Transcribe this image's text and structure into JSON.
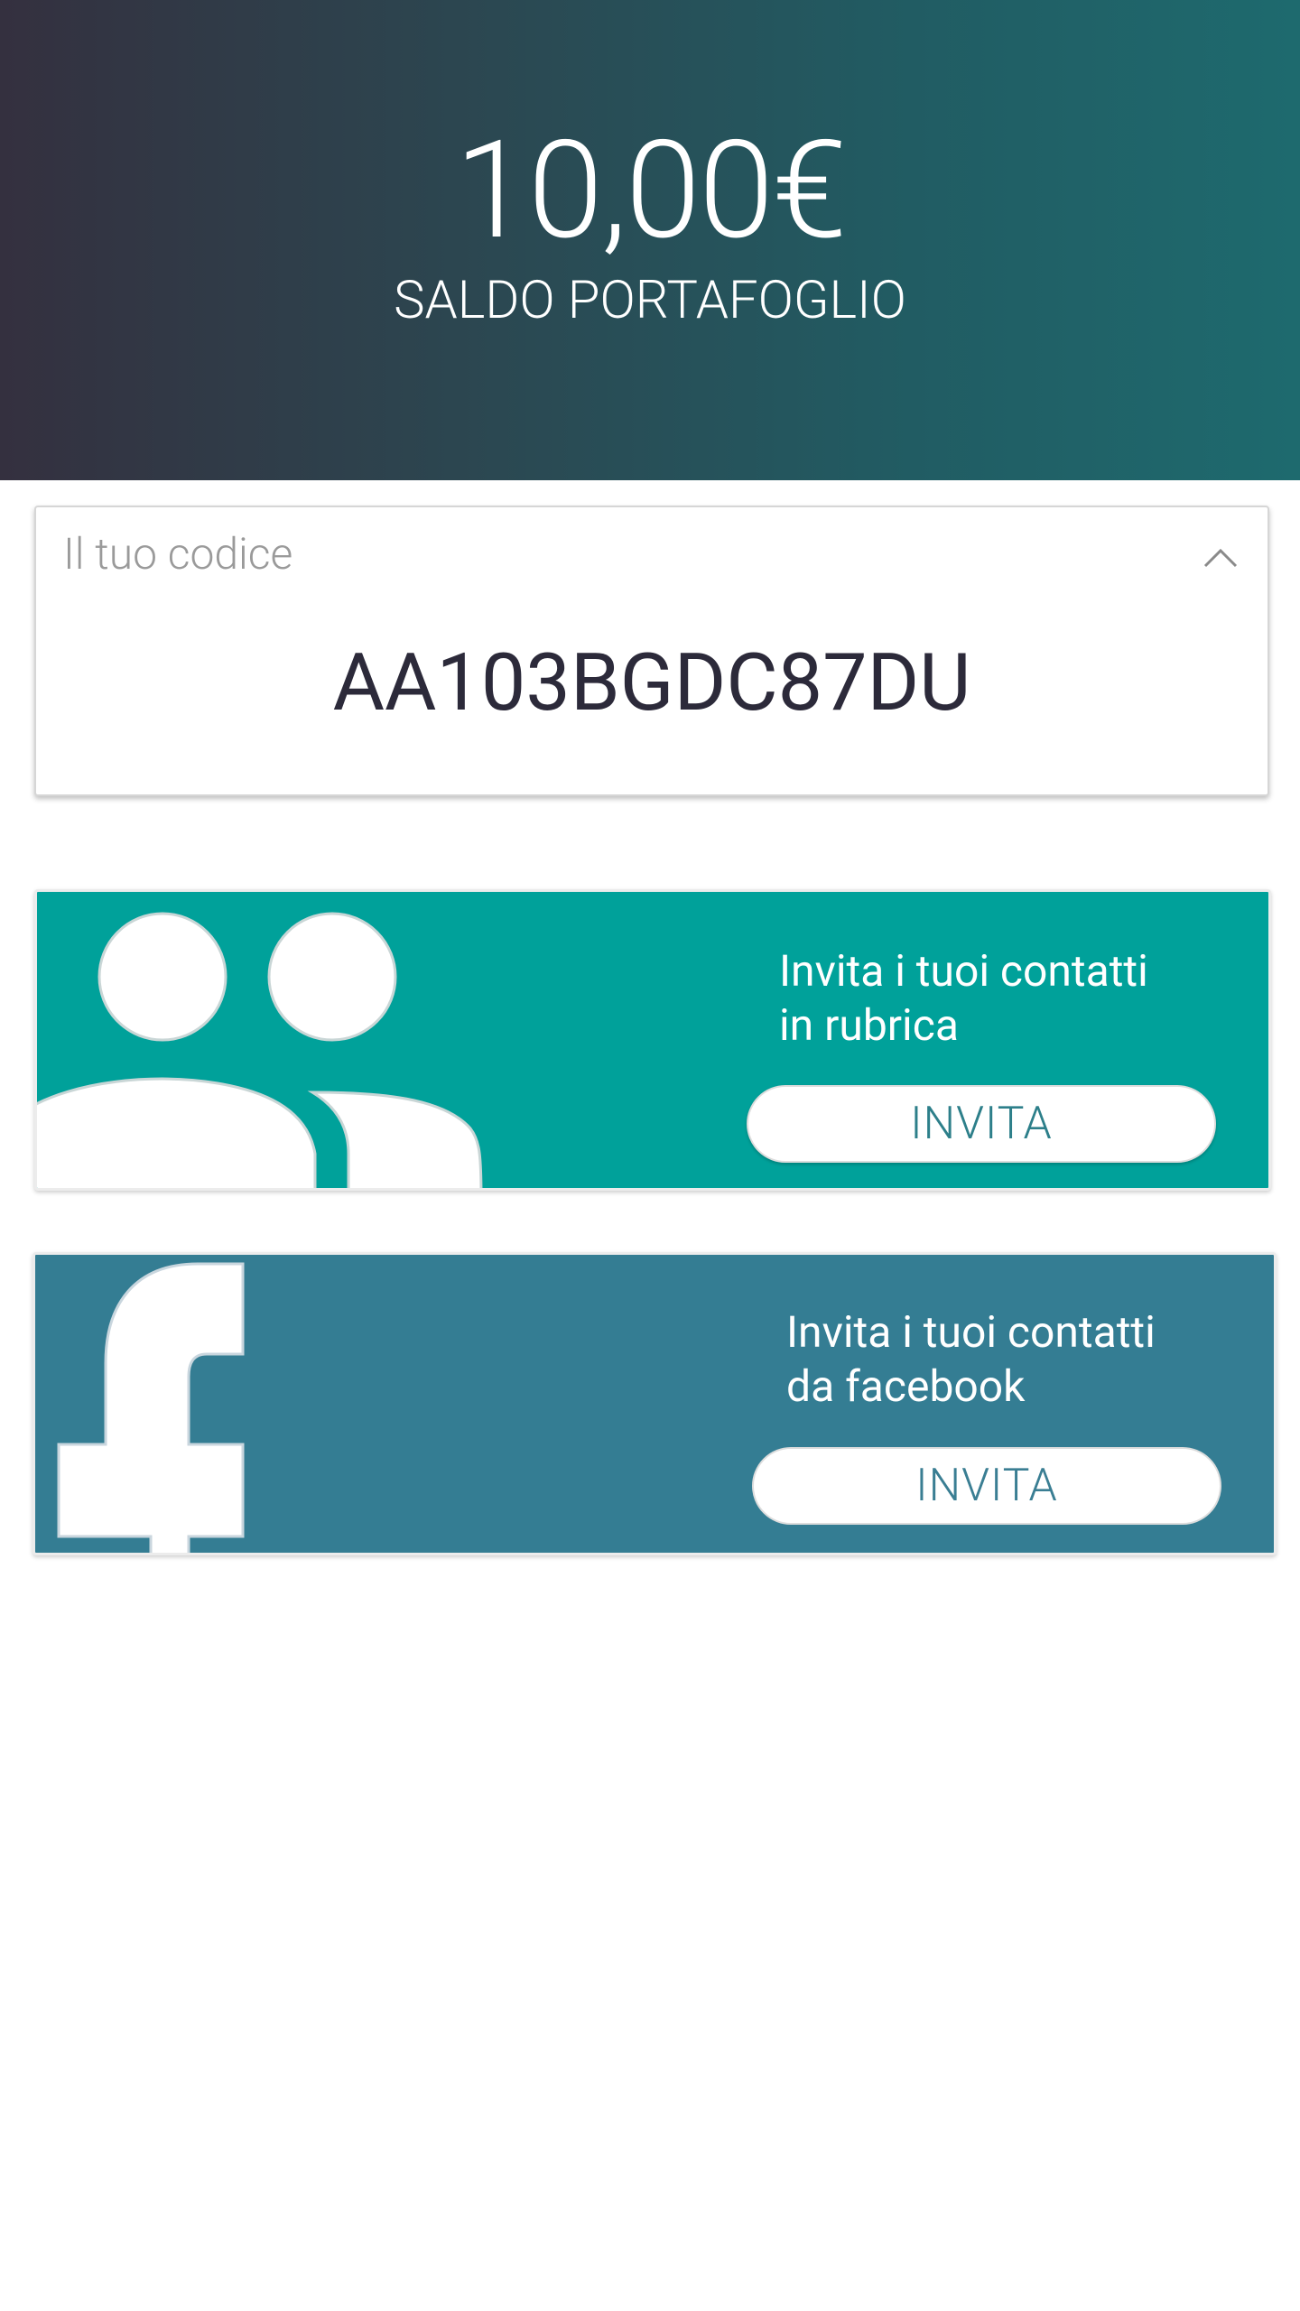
{
  "header": {
    "balance_amount": "10,00€",
    "balance_label": "SALDO PORTAFOGLIO"
  },
  "code_card": {
    "title": "Il tuo codice",
    "code": "AA103BGDC87DU"
  },
  "invite_contacts": {
    "text_line1": "Invita i tuoi contatti",
    "text_line2": "in rubrica",
    "button_label": "INVITA"
  },
  "invite_facebook": {
    "text_line1": "Invita i tuoi contatti",
    "text_line2": "da facebook",
    "button_label": "INVITA"
  },
  "icons": {
    "collapse": "chevron-up-icon",
    "contacts": "people-icon",
    "facebook": "facebook-icon"
  },
  "colors": {
    "header_gradient_start": "#34303f",
    "header_gradient_end": "#1e6a6e",
    "contacts_card": "#00a19a",
    "facebook_card": "#347d93"
  }
}
